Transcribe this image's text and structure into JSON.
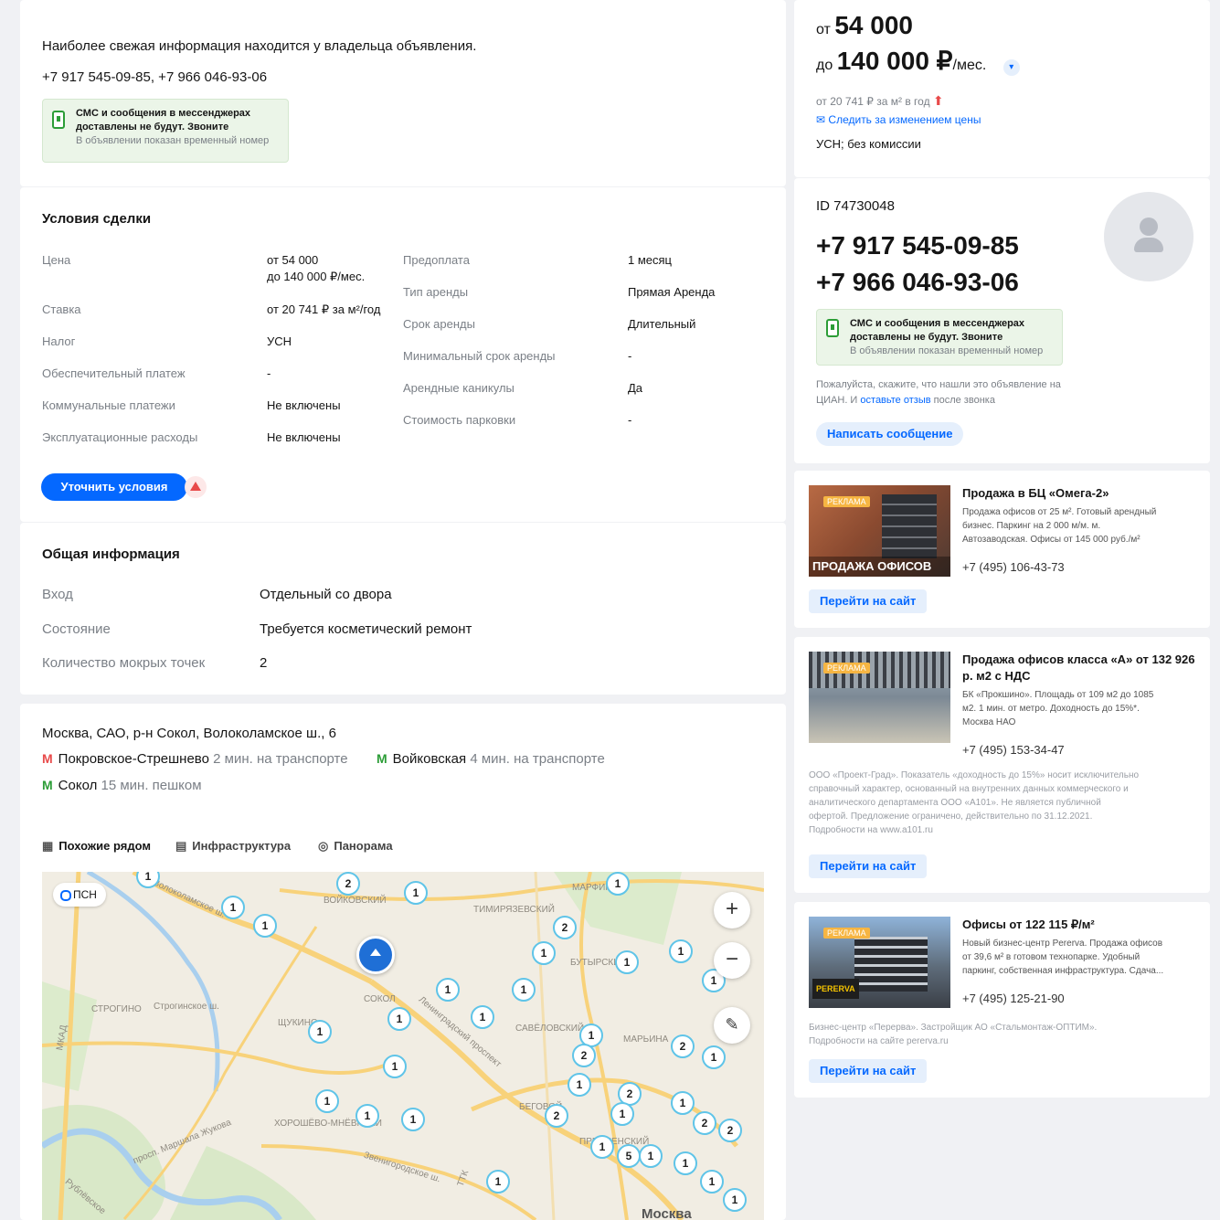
{
  "contact": {
    "note": "Наиболее свежая информация находится у владельца объявления.",
    "phones": "+7 917 545-09-85, +7 966 046-93-06",
    "sms_title": "СМС и сообщения в мессенджерах",
    "sms_title2": "доставлены не будут. Звоните",
    "sms_sub": "В объявлении показан временный номер"
  },
  "deal": {
    "title": "Условия сделки",
    "left": [
      {
        "label": "Цена",
        "value": "от 54 000",
        "value2": "до 140 000 ₽/мес."
      },
      {
        "label": "Ставка",
        "value": "от 20 741 ₽ за м²/год"
      },
      {
        "label": "Налог",
        "value": "УСН"
      },
      {
        "label": "Обеспечительный платеж",
        "value": "-"
      },
      {
        "label": "Коммунальные платежи",
        "value": "Не включены"
      },
      {
        "label": "Эксплуатационные расходы",
        "value": "Не включены"
      }
    ],
    "right": [
      {
        "label": "Предоплата",
        "value": "1 месяц"
      },
      {
        "label": "Тип аренды",
        "value": "Прямая Аренда"
      },
      {
        "label": "Срок аренды",
        "value": "Длительный"
      },
      {
        "label": "Минимальный срок аренды",
        "value": "-"
      },
      {
        "label": "Арендные каникулы",
        "value": "Да"
      },
      {
        "label": "Стоимость парковки",
        "value": "-"
      }
    ],
    "button": "Уточнить условия"
  },
  "general": {
    "title": "Общая информация",
    "rows": [
      {
        "label": "Вход",
        "value": "Отдельный со двора"
      },
      {
        "label": "Состояние",
        "value": "Требуется косметический ремонт"
      },
      {
        "label": "Количество мокрых точек",
        "value": "2"
      }
    ]
  },
  "location": {
    "address": "Москва, САО, р-н Сокол, Волоколамское ш., 6",
    "metro": [
      {
        "name": "Покровское-Стрешнево",
        "time": "2 мин. на транспорте",
        "color": "#e84a4a"
      },
      {
        "name": "Войковская",
        "time": "4 мин. на транспорте",
        "color": "#2c9d37"
      },
      {
        "name": "Сокол",
        "time": "15 мин. пешком",
        "color": "#2c9d37"
      }
    ],
    "tabs": [
      "Похожие рядом",
      "Инфраструктура",
      "Панорама"
    ],
    "map": {
      "psn_label": "ПСН",
      "zoom_in": "+",
      "zoom_out": "−",
      "labels": [
        "Волоколамское ш.",
        "ВОЙКОВСКИЙ",
        "ТИМИРЯЗЕВСКИЙ",
        "МАРФИНО",
        "СТРОГИНО",
        "Строгинское ш.",
        "ЩУКИНО",
        "СОКОЛ",
        "Ленинградский проспект",
        "САВЁЛОВСКИЙ",
        "МАРЬИНА",
        "БУТЫРСКИЙ",
        "ХОРОШЁВО-МНЁВНИКИ",
        "Звенигородское ш.",
        "Москва",
        "МКАД",
        "ПРЕСНЕНСКИЙ",
        "просп. Маршала Жукова",
        "БЕГОВОЙ",
        "Рублёвское",
        "ТТК"
      ],
      "pins": [
        "1",
        "2",
        "1",
        "1",
        "1",
        "2",
        "1",
        "1",
        "1",
        "1",
        "1",
        "1",
        "1",
        "1",
        "1",
        "1",
        "1",
        "1",
        "2",
        "1",
        "2",
        "1",
        "1",
        "1",
        "2",
        "1",
        "2",
        "2",
        "1",
        "1",
        "5",
        "1",
        "1",
        "1",
        "2",
        "1",
        "1",
        "1"
      ]
    }
  },
  "price": {
    "from_prefix": "от",
    "from_value": "54 000",
    "to_prefix": "до",
    "to_value": "140 000 ₽",
    "unit": "/мес.",
    "rate": "от 20 741 ₽ за м² в год",
    "follow": "Следить за изменением цены",
    "tax": "УСН; без комиссии"
  },
  "owner": {
    "id": "ID 74730048",
    "phone1": "+7 917 545-09-85",
    "phone2": "+7 966 046-93-06",
    "feedback1": "Пожалуйста, скажите, что нашли это объявление на",
    "feedback2": "ЦИАН. И",
    "feedback_link": "оставьте отзыв",
    "feedback3": "после звонка",
    "message_btn": "Написать сообщение"
  },
  "ads": [
    {
      "badge": "РЕКЛАМА",
      "img_caption": "ПРОДАЖА ОФИСОВ",
      "title": "Продажа в БЦ «Омега-2»",
      "text": [
        "Продажа офисов от 25 м². Готовый арендный",
        "бизнес. Паркинг на 2 000 м/м. м.",
        "Автозаводская. Офисы от 145 000 руб./м²"
      ],
      "phone": "+7 (495) 106-43-73",
      "link": "Перейти на сайт"
    },
    {
      "badge": "РЕКЛАМА",
      "title": [
        "Продажа офисов класса «А» от 132 926",
        "р. м2 с НДС"
      ],
      "text": [
        "БК «Прокшино». Площадь от 109 м2 до 1085",
        "м2. 1 мин. от метро. Доходность до 15%*.",
        "Москва НАО"
      ],
      "phone": "+7 (495) 153-34-47",
      "disclaimer": [
        "ООО «Проект-Град». Показатель «доходность до 15%» носит исключительно",
        "справочный характер, основанный на внутренних данных коммерческого и",
        "аналитического департамента ООО «А101». Не является публичной",
        "офертой. Предложение ограничено, действительно по 31.12.2021.",
        "Подробности на www.a101.ru"
      ],
      "link": "Перейти на сайт"
    },
    {
      "badge": "РЕКЛАМА",
      "img_caption": "PERERVA",
      "title": "Офисы от 122 115 ₽/м²",
      "text": [
        "Новый бизнес-центр Pererva. Продажа офисов",
        "от 39,6 м² в готовом технопарке. Удобный",
        "паркинг, собственная инфраструктура. Сдача..."
      ],
      "phone": "+7 (495) 125-21-90",
      "disclaimer": [
        "Бизнес-центр «Перерва». Застройщик АО «Стальмонтаж-ОПТИМ».",
        "Подробности на сайте pererva.ru"
      ],
      "link": "Перейти на сайт"
    }
  ]
}
